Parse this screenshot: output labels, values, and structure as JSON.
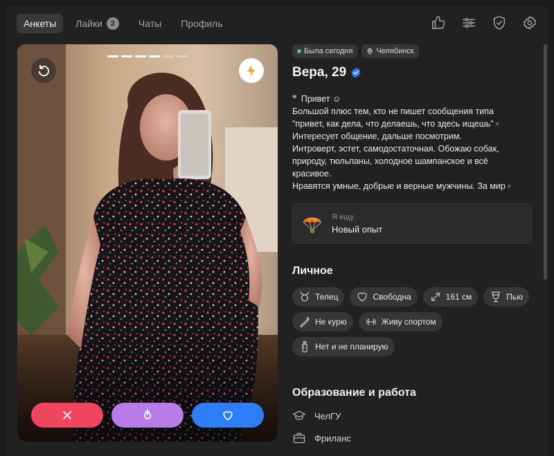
{
  "nav": {
    "tabs": [
      {
        "label": "Анкеты",
        "active": true
      },
      {
        "label": "Лайки",
        "badge": "2"
      },
      {
        "label": "Чаты"
      },
      {
        "label": "Профиль"
      }
    ],
    "icons": [
      "thumbs-up-icon",
      "filters-icon",
      "shield-check-icon",
      "settings-icon"
    ]
  },
  "photo": {
    "progress_total": 6,
    "progress_active": 4,
    "undo_icon": "undo-icon",
    "boost_icon": "lightning-icon",
    "actions": [
      "dislike-icon",
      "superlike-flame-icon",
      "like-heart-icon"
    ]
  },
  "profile": {
    "status": "Была сегодня",
    "city": "Челябинск",
    "name": "Вера, 29",
    "verified": true,
    "bio_lines": [
      "Привет ☺",
      "Большой плюс тем, кто не пишет сообщения типа",
      "\"привет, как дела, что делаешь, что здесь ищешь\" ▫",
      "Интересует общение, дальше посмотрим.",
      "Интроверт, эстет, самодостаточная. Обожаю собак,",
      "природу, тюльпаны, холодное шампанское и всё",
      "красивое.",
      "Нравятся умные, добрые и верные мужчины. За мир ▫"
    ],
    "seeking": {
      "label": "Я ищу",
      "value": "Новый опыт"
    },
    "personal_title": "Личное",
    "tags": [
      {
        "icon": "taurus-icon",
        "text": "Телец"
      },
      {
        "icon": "heart-icon",
        "text": "Свободна"
      },
      {
        "icon": "height-icon",
        "text": "161 см"
      },
      {
        "icon": "glass-icon",
        "text": "Пью"
      },
      {
        "icon": "no-smoking-icon",
        "text": "Не курю"
      },
      {
        "icon": "dumbbell-icon",
        "text": "Живу спортом"
      },
      {
        "icon": "baby-bottle-icon",
        "text": "Нет и не планирую"
      }
    ],
    "education_title": "Образование и работа",
    "education": [
      {
        "icon": "graduation-cap-icon",
        "text": "ЧелГУ"
      },
      {
        "icon": "briefcase-icon",
        "text": "Фриланс"
      }
    ]
  },
  "colors": {
    "background": "#212122",
    "dislike": "#f0455f",
    "superlike": "#b87ce8",
    "like": "#2d7df5",
    "verified": "#2d7df5",
    "online": "#3fd66b"
  }
}
